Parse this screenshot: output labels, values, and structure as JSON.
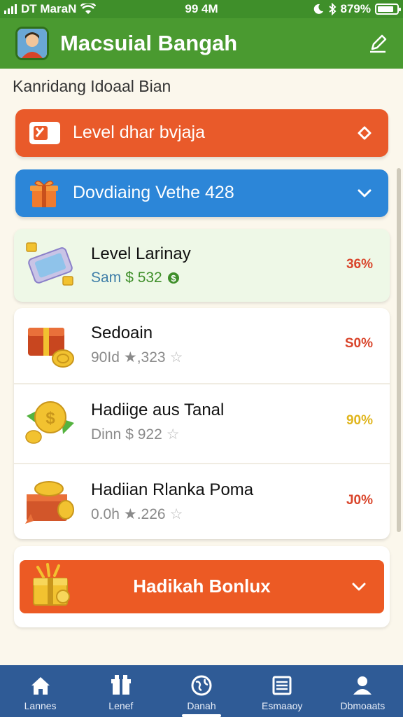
{
  "status_bar": {
    "carrier": "DT MaraN",
    "time": "99 4M",
    "battery": "879%",
    "battery_level": 0.85
  },
  "header": {
    "title": "Macsuial Bangah"
  },
  "subtitle": "Kanridang Idoaal Bian",
  "banners": [
    {
      "label": "Level dhar bvjaja",
      "color": "#e95a2a"
    },
    {
      "label": "Dovdiaing Vethe 428",
      "color": "#2c86d8"
    }
  ],
  "items": [
    {
      "title": "Level Larinay",
      "meta_prefix": "Sam",
      "meta_value": "$ 532",
      "percent": "36%",
      "percent_color": "#d9442a",
      "icon": "phone-coins-icon"
    },
    {
      "title": "Sedoain",
      "meta_prefix": "90Id",
      "meta_value": "★,323",
      "percent": "S0%",
      "percent_color": "#d9442a",
      "icon": "gift-box-coins-icon"
    },
    {
      "title": "Hadiige aus Tanal",
      "meta_prefix": "Dinn",
      "meta_value": "$ 922",
      "percent": "90%",
      "percent_color": "#e0b51c",
      "icon": "coin-ribbon-icon"
    },
    {
      "title": "Hadiian Rlanka Poma",
      "meta_prefix": "0.0h",
      "meta_value": "★.226",
      "percent": "J0%",
      "percent_color": "#d9442a",
      "icon": "treasure-chest-icon"
    }
  ],
  "bonus": {
    "label": "Hadikah Bonlux"
  },
  "nav": [
    {
      "label": "Lannes",
      "icon": "home-icon"
    },
    {
      "label": "Lenef",
      "icon": "gift-icon"
    },
    {
      "label": "Danah",
      "icon": "globe-icon",
      "active": true
    },
    {
      "label": "Esmaaoy",
      "icon": "list-icon"
    },
    {
      "label": "Dbmoaats",
      "icon": "profile-icon"
    }
  ]
}
